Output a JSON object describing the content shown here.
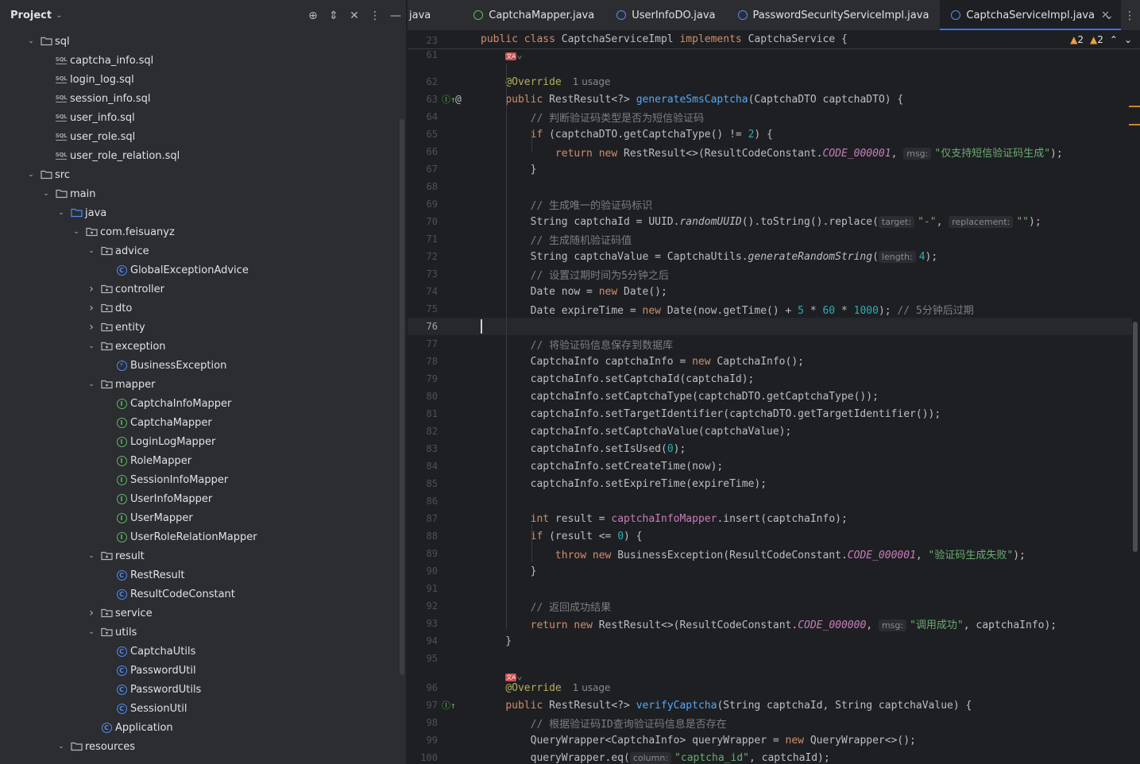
{
  "project_panel": {
    "title": "Project",
    "icons": [
      "locate-icon",
      "expand-icon",
      "collapse-icon",
      "more-icon",
      "minimize-icon"
    ],
    "tree": [
      {
        "label": "sql",
        "type": "folder",
        "depth": 1,
        "expanded": true
      },
      {
        "label": "captcha_info.sql",
        "type": "sql",
        "depth": 2
      },
      {
        "label": "login_log.sql",
        "type": "sql",
        "depth": 2
      },
      {
        "label": "session_info.sql",
        "type": "sql",
        "depth": 2
      },
      {
        "label": "user_info.sql",
        "type": "sql",
        "depth": 2
      },
      {
        "label": "user_role.sql",
        "type": "sql",
        "depth": 2
      },
      {
        "label": "user_role_relation.sql",
        "type": "sql",
        "depth": 2
      },
      {
        "label": "src",
        "type": "folder",
        "depth": 1,
        "expanded": true
      },
      {
        "label": "main",
        "type": "folder",
        "depth": 2,
        "expanded": true
      },
      {
        "label": "java",
        "type": "srcfolder",
        "depth": 3,
        "expanded": true
      },
      {
        "label": "com.feisuanyz",
        "type": "package",
        "depth": 4,
        "expanded": true
      },
      {
        "label": "advice",
        "type": "package",
        "depth": 5,
        "expanded": true
      },
      {
        "label": "GlobalExceptionAdvice",
        "type": "class",
        "depth": 6
      },
      {
        "label": "controller",
        "type": "package",
        "depth": 5,
        "expanded": false
      },
      {
        "label": "dto",
        "type": "package",
        "depth": 5,
        "expanded": false
      },
      {
        "label": "entity",
        "type": "package",
        "depth": 5,
        "expanded": false
      },
      {
        "label": "exception",
        "type": "package",
        "depth": 5,
        "expanded": true
      },
      {
        "label": "BusinessException",
        "type": "exception",
        "depth": 6
      },
      {
        "label": "mapper",
        "type": "package",
        "depth": 5,
        "expanded": true
      },
      {
        "label": "CaptchaInfoMapper",
        "type": "interface",
        "depth": 6
      },
      {
        "label": "CaptchaMapper",
        "type": "interface",
        "depth": 6
      },
      {
        "label": "LoginLogMapper",
        "type": "interface",
        "depth": 6
      },
      {
        "label": "RoleMapper",
        "type": "interface",
        "depth": 6
      },
      {
        "label": "SessionInfoMapper",
        "type": "interface",
        "depth": 6
      },
      {
        "label": "UserInfoMapper",
        "type": "interface",
        "depth": 6
      },
      {
        "label": "UserMapper",
        "type": "interface",
        "depth": 6
      },
      {
        "label": "UserRoleRelationMapper",
        "type": "interface",
        "depth": 6
      },
      {
        "label": "result",
        "type": "package",
        "depth": 5,
        "expanded": true
      },
      {
        "label": "RestResult",
        "type": "class",
        "depth": 6
      },
      {
        "label": "ResultCodeConstant",
        "type": "class",
        "depth": 6
      },
      {
        "label": "service",
        "type": "package",
        "depth": 5,
        "expanded": false
      },
      {
        "label": "utils",
        "type": "package",
        "depth": 5,
        "expanded": true
      },
      {
        "label": "CaptchaUtils",
        "type": "class",
        "depth": 6
      },
      {
        "label": "PasswordUtil",
        "type": "class",
        "depth": 6
      },
      {
        "label": "PasswordUtils",
        "type": "class",
        "depth": 6
      },
      {
        "label": "SessionUtil",
        "type": "class",
        "depth": 6
      },
      {
        "label": "Application",
        "type": "appclass",
        "depth": 5
      },
      {
        "label": "resources",
        "type": "resfolder",
        "depth": 3,
        "expanded": true
      }
    ]
  },
  "editor": {
    "tabs": [
      {
        "label": "java",
        "icon": "none",
        "active": false
      },
      {
        "label": "CaptchaMapper.java",
        "icon": "interface",
        "active": false
      },
      {
        "label": "UserInfoDO.java",
        "icon": "class",
        "active": false
      },
      {
        "label": "PasswordSecurityServiceImpl.java",
        "icon": "class",
        "active": false
      },
      {
        "label": "CaptchaServiceImpl.java",
        "icon": "class",
        "active": true
      }
    ],
    "warnings": {
      "weak": "2",
      "strong": "2"
    },
    "sticky": {
      "num": "23",
      "html": "<span class=\"kw\">public class</span> CaptchaServiceImpl <span class=\"kw\">implements</span> CaptchaService {"
    },
    "lines": [
      {
        "num": "61",
        "html": "    <span class=\"translate\">文A</span><span class=\"cm\">⌄</span>"
      },
      {
        "num": "62",
        "html": "    <span class=\"ann\">@Override</span><span class=\"usage\">1 usage</span>"
      },
      {
        "num": "63",
        "gutter": "impl",
        "html": "    <span class=\"kw\">public</span> RestResult&lt;?&gt; <span class=\"fn\">generateSmsCaptcha</span>(CaptchaDTO captchaDTO) {"
      },
      {
        "num": "64",
        "html": "        <span class=\"cm\">// 判断验证码类型是否为短信验证码</span>"
      },
      {
        "num": "65",
        "html": "        <span class=\"kw\">if</span> (captchaDTO.getCaptchaType() != <span class=\"num\">2</span>) {"
      },
      {
        "num": "66",
        "html": "            <span class=\"kw\">return new</span> RestResult&lt;&gt;(ResultCodeConstant.<span class=\"cst\">CODE_000001</span>, <span class=\"hint\">msg:</span><span class=\"str\">\"仅支持短信验证码生成\"</span>);"
      },
      {
        "num": "67",
        "html": "        }"
      },
      {
        "num": "68",
        "html": ""
      },
      {
        "num": "69",
        "html": "        <span class=\"cm\">// 生成唯一的验证码标识</span>"
      },
      {
        "num": "70",
        "html": "        String captchaId = UUID.<span class=\"it\">randomUUID</span>().toString().replace(<span class=\"hint\">target:</span><span class=\"str\">\"-\"</span>, <span class=\"hint\">replacement:</span><span class=\"str\">\"\"</span>);"
      },
      {
        "num": "71",
        "html": "        <span class=\"cm\">// 生成随机验证码值</span>"
      },
      {
        "num": "72",
        "html": "        String captchaValue = CaptchaUtils.<span class=\"it\">generateRandomString</span>(<span class=\"hint\">length:</span><span class=\"num\">4</span>);"
      },
      {
        "num": "73",
        "html": "        <span class=\"cm\">// 设置过期时间为5分钟之后</span>"
      },
      {
        "num": "74",
        "html": "        Date now = <span class=\"kw\">new</span> Date();"
      },
      {
        "num": "75",
        "html": "        Date expireTime = <span class=\"kw\">new</span> Date(now.getTime() + <span class=\"num\">5</span> * <span class=\"num\">60</span> * <span class=\"num\">1000</span>); <span class=\"cm\">// 5分钟后过期</span>"
      },
      {
        "num": "76",
        "html": "",
        "current": true
      },
      {
        "num": "77",
        "html": "        <span class=\"cm\">// 将验证码信息保存到数据库</span>"
      },
      {
        "num": "78",
        "html": "        CaptchaInfo captchaInfo = <span class=\"kw\">new</span> CaptchaInfo();"
      },
      {
        "num": "79",
        "html": "        captchaInfo.setCaptchaId(captchaId);"
      },
      {
        "num": "80",
        "html": "        captchaInfo.setCaptchaType(captchaDTO.getCaptchaType());"
      },
      {
        "num": "81",
        "html": "        captchaInfo.setTargetIdentifier(captchaDTO.getTargetIdentifier());"
      },
      {
        "num": "82",
        "html": "        captchaInfo.setCaptchaValue(captchaValue);"
      },
      {
        "num": "83",
        "html": "        captchaInfo.setIsUsed(<span class=\"num\">0</span>);"
      },
      {
        "num": "84",
        "html": "        captchaInfo.setCreateTime(now);"
      },
      {
        "num": "85",
        "html": "        captchaInfo.setExpireTime(expireTime);"
      },
      {
        "num": "86",
        "html": ""
      },
      {
        "num": "87",
        "html": "        <span class=\"kw\">int</span> result = <span class=\"fld\">captchaInfoMapper</span>.insert(captchaInfo);"
      },
      {
        "num": "88",
        "html": "        <span class=\"kw\">if</span> (result &lt;= <span class=\"num\">0</span>) {"
      },
      {
        "num": "89",
        "html": "            <span class=\"kw\">throw new</span> BusinessException(ResultCodeConstant.<span class=\"cst\">CODE_000001</span>, <span class=\"str\">\"验证码生成失败\"</span>);"
      },
      {
        "num": "90",
        "html": "        }"
      },
      {
        "num": "91",
        "html": ""
      },
      {
        "num": "92",
        "html": "        <span class=\"cm\">// 返回成功结果</span>"
      },
      {
        "num": "93",
        "html": "        <span class=\"kw\">return new</span> RestResult&lt;&gt;(ResultCodeConstant.<span class=\"cst\">CODE_000000</span>, <span class=\"hint\">msg:</span><span class=\"str\">\"调用成功\"</span>, captchaInfo);"
      },
      {
        "num": "94",
        "html": "    }"
      },
      {
        "num": "95",
        "html": ""
      },
      {
        "num": "",
        "html": "    <span class=\"translate\">文A</span><span class=\"cm\">⌄</span>"
      },
      {
        "num": "96",
        "html": "    <span class=\"ann\">@Override</span><span class=\"usage\">1 usage</span>"
      },
      {
        "num": "97",
        "gutter": "impl-only",
        "html": "    <span class=\"kw\">public</span> RestResult&lt;?&gt; <span class=\"fn\">verifyCaptcha</span>(String captchaId, String captchaValue) {"
      },
      {
        "num": "98",
        "html": "        <span class=\"cm\">// 根据验证码ID查询验证码信息是否存在</span>"
      },
      {
        "num": "99",
        "html": "        QueryWrapper&lt;CaptchaInfo&gt; queryWrapper = <span class=\"kw\">new</span> QueryWrapper&lt;&gt;();"
      },
      {
        "num": "100",
        "html": "        queryWrapper.eq(<span class=\"hint\">column:</span><span class=\"str\">\"captcha_id\"</span>, captchaId);"
      }
    ]
  }
}
